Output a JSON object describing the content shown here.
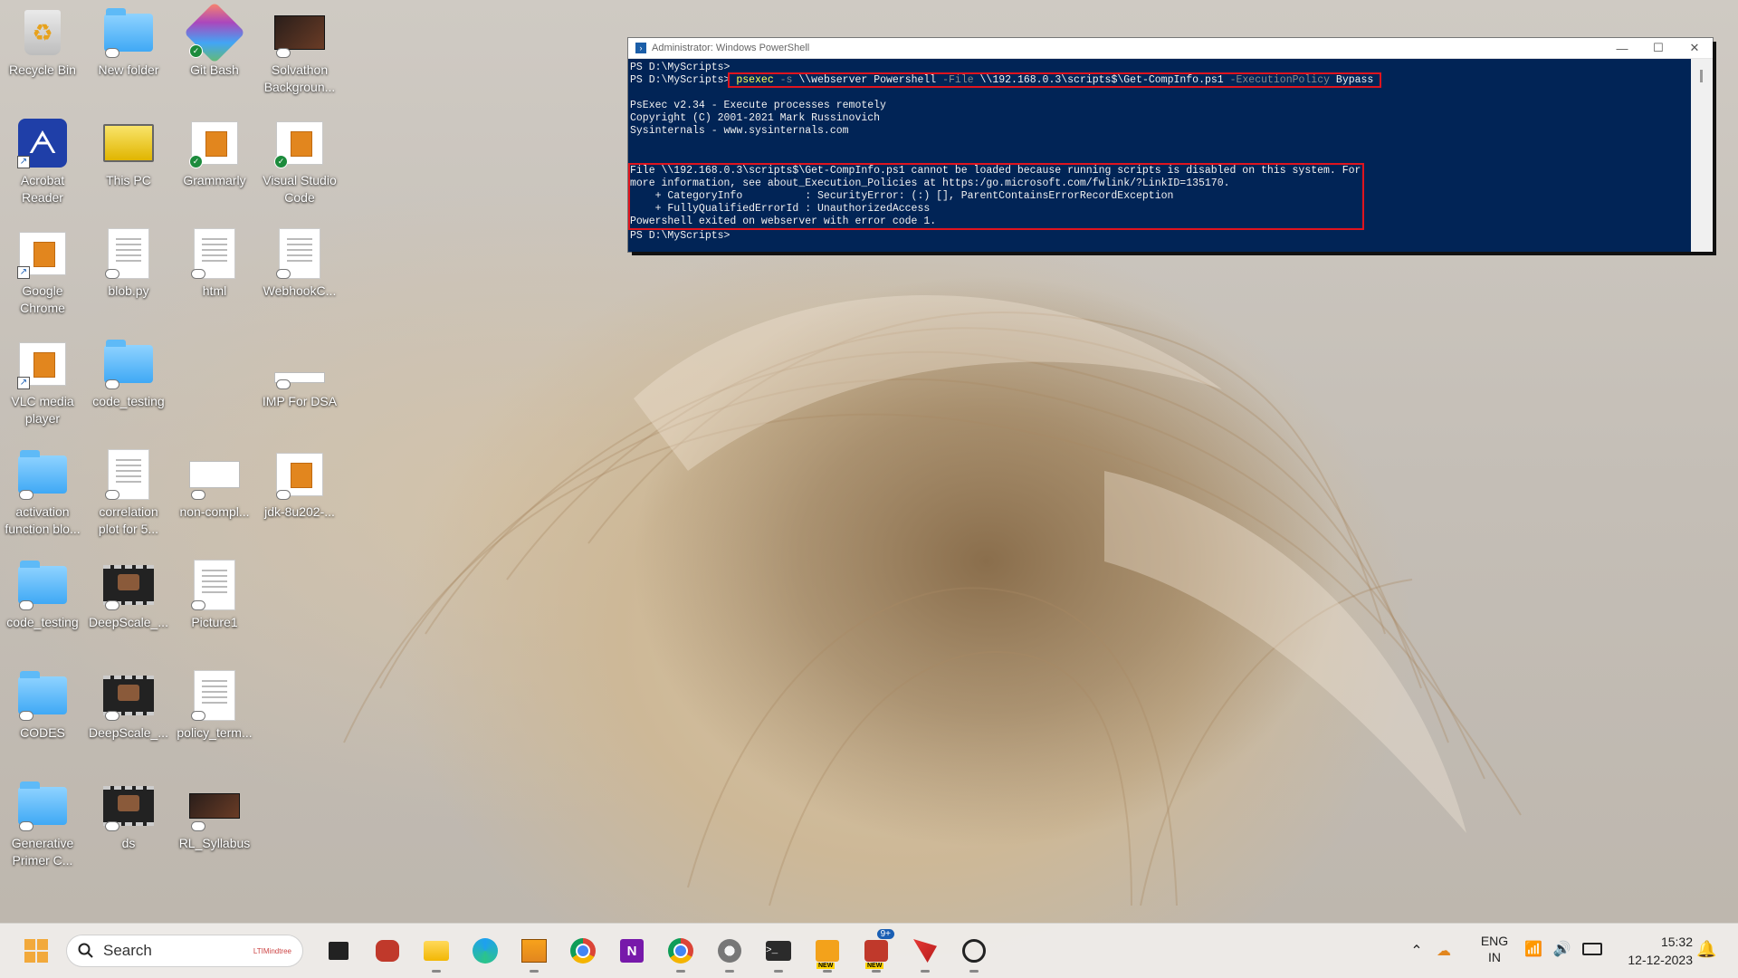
{
  "desktop": {
    "icons": [
      {
        "label": "Recycle Bin"
      },
      {
        "label": "New folder"
      },
      {
        "label": "Git Bash"
      },
      {
        "label": "Solvathon\nBackgroun..."
      },
      {
        "label": "Acrobat\nReader"
      },
      {
        "label": "This PC"
      },
      {
        "label": "Grammarly"
      },
      {
        "label": "Visual Studio\nCode"
      },
      {
        "label": "Google\nChrome"
      },
      {
        "label": "blob.py"
      },
      {
        "label": "html"
      },
      {
        "label": "WebhookC..."
      },
      {
        "label": "VLC media\nplayer"
      },
      {
        "label": "code_testing"
      },
      {
        "label": "IMP For DSA"
      },
      {
        "label": "activation\nfunction blo..."
      },
      {
        "label": "correlation\nplot for 5..."
      },
      {
        "label": "non-compl..."
      },
      {
        "label": "jdk-8u202-..."
      },
      {
        "label": "code_testing"
      },
      {
        "label": "DeepScale_..."
      },
      {
        "label": "Picture1"
      },
      {
        "label": "CODES"
      },
      {
        "label": "DeepScale_..."
      },
      {
        "label": "policy_term..."
      },
      {
        "label": "Generative\nPrimer C..."
      },
      {
        "label": "ds"
      },
      {
        "label": "RL_Syllabus"
      }
    ]
  },
  "powershell": {
    "title": "Administrator: Windows PowerShell",
    "prompt1": "PS D:\\MyScripts>",
    "prompt2": "PS D:\\MyScripts>",
    "cmd": {
      "exe": "psexec",
      "flag_s": "-s",
      "target": "\\\\webserver Powershell",
      "flag_file": "-File",
      "path": "\\\\192.168.0.3\\scripts$\\Get-CompInfo.ps1",
      "flag_policy": "-ExecutionPolicy",
      "policy": "Bypass"
    },
    "banner": [
      "PsExec v2.34 - Execute processes remotely",
      "Copyright (C) 2001-2021 Mark Russinovich",
      "Sysinternals - www.sysinternals.com"
    ],
    "error": [
      "File \\\\192.168.0.3\\scripts$\\Get-CompInfo.ps1 cannot be loaded because running scripts is disabled on this system. For",
      "more information, see about_Execution_Policies at https:/go.microsoft.com/fwlink/?LinkID=135170.",
      "    + CategoryInfo          : SecurityError: (:) [], ParentContainsErrorRecordException",
      "    + FullyQualifiedErrorId : UnauthorizedAccess",
      "Powershell exited on webserver with error code 1."
    ],
    "prompt3": "PS D:\\MyScripts>"
  },
  "taskbar": {
    "search_placeholder": "Search",
    "search_badge": "LTIMindtree",
    "teams_badge": "9+",
    "new_tag_1": "NEW",
    "new_tag_2": "NEW",
    "lang_line1": "ENG",
    "lang_line2": "IN",
    "time": "15:32",
    "date": "12-12-2023"
  },
  "colors": {
    "console_bg": "#012456",
    "highlight_red": "#e0141e",
    "command_yellow": "#ffff55"
  }
}
